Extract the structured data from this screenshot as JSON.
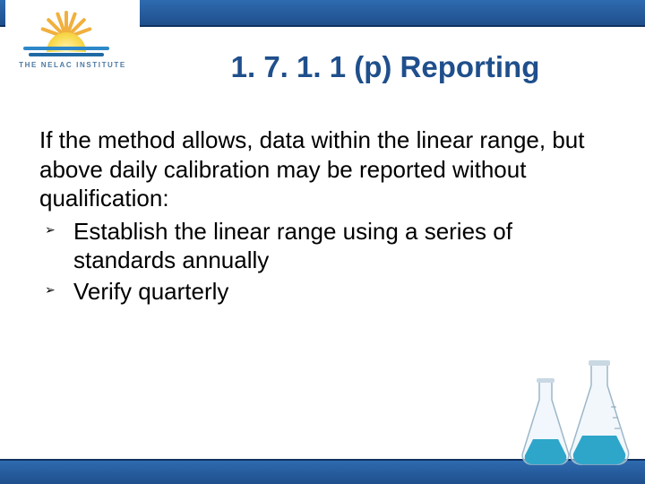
{
  "logo": {
    "text": "THE NELAC INSTITUTE"
  },
  "title": "1. 7. 1. 1 (p) Reporting",
  "intro": "If the method allows, data within the linear range, but above daily calibration may be reported without qualification:",
  "bullets": [
    "Establish the linear range using a series of standards annually",
    "Verify quarterly"
  ],
  "colors": {
    "accent": "#1f4f8c",
    "flask_liquid": "#2ea6c9"
  }
}
